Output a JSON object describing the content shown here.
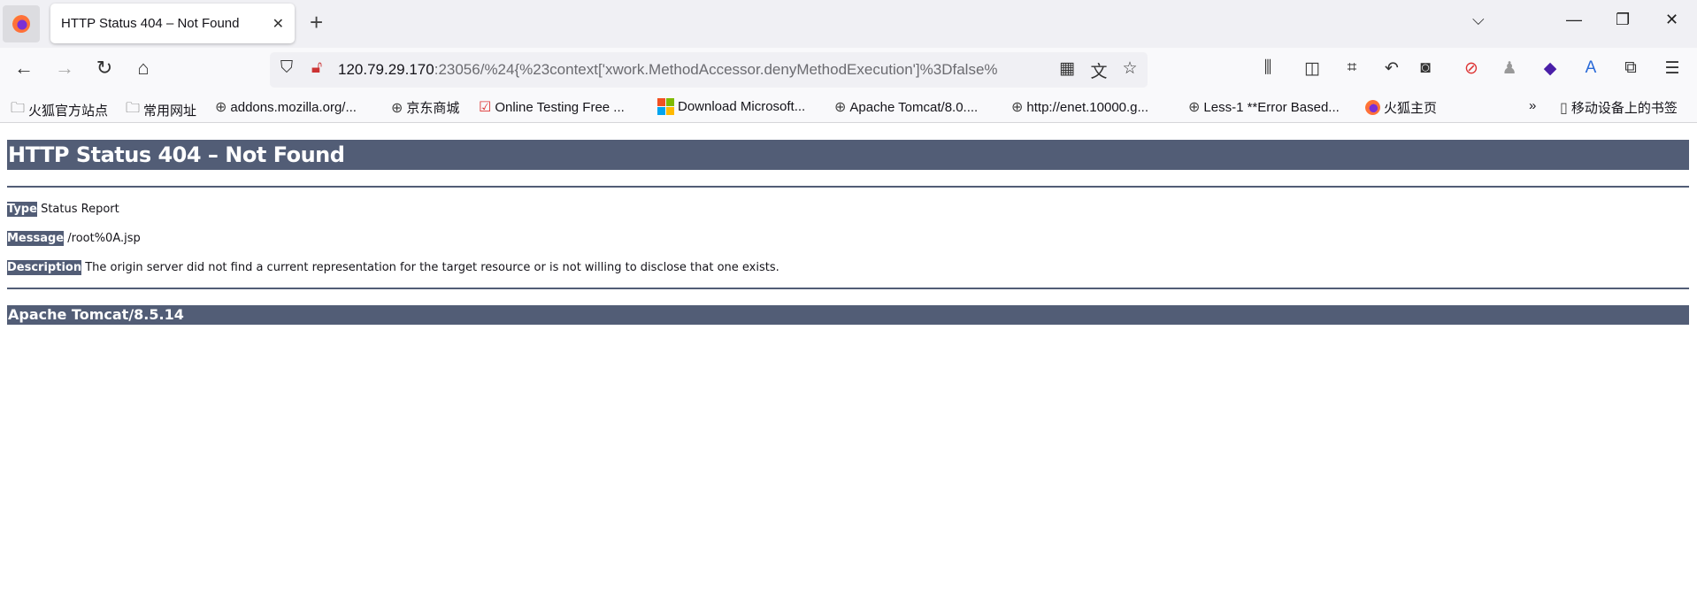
{
  "browser": {
    "tab_title": "HTTP Status 404 – Not Found",
    "url_host": "120.79.29.170",
    "url_rest": ":23056/%24{%23context['xwork.MethodAccessor.denyMethodExecution']%3Dfalse%",
    "bookmarks": [
      {
        "label": "火狐官方站点",
        "icon": "folder-icon"
      },
      {
        "label": "常用网址",
        "icon": "folder-icon"
      },
      {
        "label": "addons.mozilla.org/...",
        "icon": "globe-icon"
      },
      {
        "label": "京东商城",
        "icon": "globe-icon"
      },
      {
        "label": "Online Testing Free ...",
        "icon": "checkbox-icon"
      },
      {
        "label": "Download Microsoft...",
        "icon": "microsoft-icon"
      },
      {
        "label": "Apache Tomcat/8.0....",
        "icon": "globe-icon"
      },
      {
        "label": "http://enet.10000.g...",
        "icon": "globe-icon"
      },
      {
        "label": "Less-1 **Error Based...",
        "icon": "globe-icon"
      },
      {
        "label": "火狐主页",
        "icon": "firefox-icon"
      }
    ],
    "mobile_bookmarks": "移动设备上的书签"
  },
  "page": {
    "title": "HTTP Status 404 – Not Found",
    "type_label": "Type",
    "type_value": "Status Report",
    "message_label": "Message",
    "message_value": "/root%0A.jsp",
    "description_label": "Description",
    "description_value": "The origin server did not find a current representation for the target resource or is not willing to disclose that one exists.",
    "footer": "Apache Tomcat/8.5.14",
    "accent": "#525d76"
  }
}
